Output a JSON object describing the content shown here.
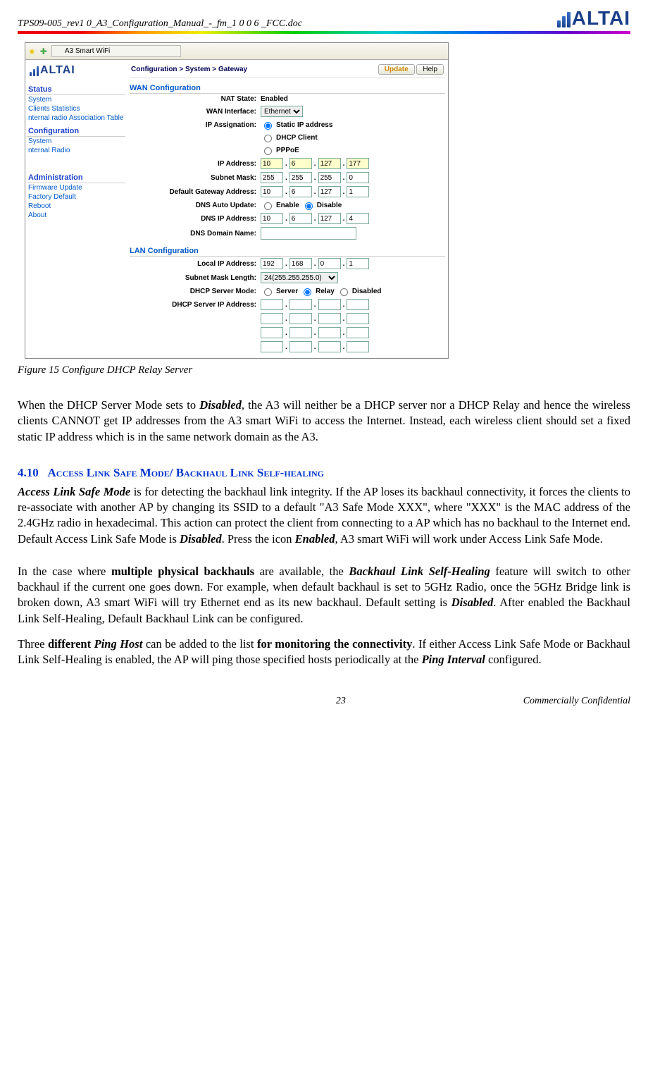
{
  "header": {
    "doc_path": "TPS09-005_rev1 0_A3_Configuration_Manual_-_fm_1 0 0 6 _FCC.doc",
    "logo_text": "ALTAI"
  },
  "screenshot": {
    "tab_title": "A3 Smart WiFi",
    "side_logo": "ALTAI",
    "sidebar": {
      "status": {
        "title": "Status",
        "items": [
          "System",
          "Clients Statistics",
          "nternal radio Association Table"
        ]
      },
      "config": {
        "title": "Configuration",
        "items": [
          "System",
          "nternal Radio"
        ]
      },
      "admin": {
        "title": "Administration",
        "items": [
          "Firmware Update",
          "Factory Default",
          "Reboot",
          "About"
        ]
      }
    },
    "breadcrumb": {
      "c1": "Configuration >",
      "c2": "System >",
      "c3": "Gateway"
    },
    "buttons": {
      "update": "Update",
      "help": "Help"
    },
    "wan": {
      "title": "WAN Configuration",
      "nat_state_label": "NAT State:",
      "nat_state_value": "Enabled",
      "wan_if_label": "WAN Interface:",
      "wan_if_value": "Ethernet",
      "ip_assign_label": "IP Assignation:",
      "opt_static": "Static IP address",
      "opt_dhcp": "DHCP Client",
      "opt_pppoe": "PPPoE",
      "ip_addr_label": "IP Address:",
      "ip_addr": [
        "10",
        "6",
        "127",
        "177"
      ],
      "subnet_label": "Subnet Mask:",
      "subnet": [
        "255",
        "255",
        "255",
        "0"
      ],
      "gw_label": "Default Gateway Address:",
      "gw": [
        "10",
        "6",
        "127",
        "1"
      ],
      "dns_auto_label": "DNS Auto Update:",
      "dns_enable": "Enable",
      "dns_disable": "Disable",
      "dns_ip_label": "DNS IP Address:",
      "dns_ip": [
        "10",
        "6",
        "127",
        "4"
      ],
      "dns_dom_label": "DNS Domain Name:"
    },
    "lan": {
      "title": "LAN Configuration",
      "local_ip_label": "Local IP Address:",
      "local_ip": [
        "192",
        "168",
        "0",
        "1"
      ],
      "mask_len_label": "Subnet Mask Length:",
      "mask_len_value": "24(255.255.255.0)",
      "dhcp_mode_label": "DHCP Server Mode:",
      "opt_server": "Server",
      "opt_relay": "Relay",
      "opt_disabled": "Disabled",
      "dhcp_srv_ip_label": "DHCP Server IP Address:"
    }
  },
  "caption": "Figure 15     Configure DHCP Relay Server",
  "body": {
    "p1a": "When the DHCP Server Mode sets to ",
    "p1b": "Disabled",
    "p1c": ", the A3 will neither be a DHCP server nor a DHCP Relay and hence the wireless clients CANNOT get IP addresses from the A3 smart WiFi to access the Internet. Instead, each wireless client should set a fixed static IP address which is in the same network domain as the A3.",
    "sec_num": "4.10",
    "sec_title": "Access Link Safe Mode/ Backhaul Link Self-healing",
    "p2a": "Access Link Safe Mode",
    "p2b": " is for detecting the backhaul link integrity. If the AP loses its backhaul connectivity, it forces the clients to re-associate with another AP by changing its SSID to a default \"A3 Safe Mode XXX\", where \"XXX\" is the MAC address of the 2.4GHz radio in hexadecimal. This action can protect the client from connecting to a AP which has no backhaul to the Internet end. Default Access Link Safe Mode is ",
    "p2c": "Disabled",
    "p2d": ". Press the icon ",
    "p2e": "Enabled",
    "p2f": ", A3 smart WiFi will work under Access Link Safe Mode.",
    "p3a": "In the case where ",
    "p3b": "multiple physical backhauls",
    "p3c": " are available, the ",
    "p3d": "Backhaul Link Self-Healing",
    "p3e": " feature will switch to other backhaul if the current one goes down. For example, when default backhaul is set to 5GHz Radio, once the 5GHz Bridge link is broken down, A3 smart WiFi will try Ethernet end as its new backhaul. Default setting is ",
    "p3f": "Disabled",
    "p3g": ". After enabled the Backhaul Link Self-Healing, Default Backhaul Link can be configured.",
    "p4a": "Three ",
    "p4b": "different ",
    "p4c": "Ping Host",
    "p4d": " can be added to the list ",
    "p4e": "for monitoring the connectivity",
    "p4f": ". If either Access Link Safe Mode or Backhaul Link Self-Healing is enabled, the AP will ping those specified hosts periodically at the ",
    "p4g": "Ping Interval",
    "p4h": " configured."
  },
  "footer": {
    "page": "23",
    "conf": "Commercially Confidential"
  }
}
